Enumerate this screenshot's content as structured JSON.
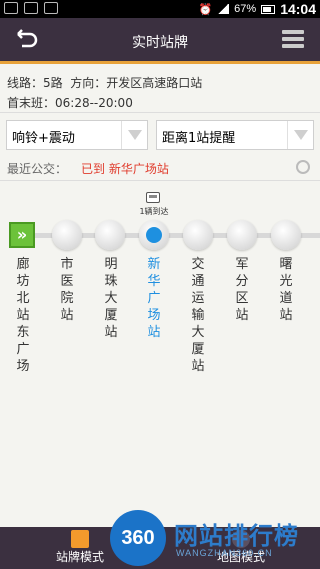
{
  "status": {
    "battery": "67%",
    "time": "14:04"
  },
  "header": {
    "title": "实时站牌"
  },
  "info": {
    "route_label": "线路：5路",
    "direction_label": "方向：开发区高速路口站",
    "schedule_label": "首末班：06:28--20:00"
  },
  "dropdowns": {
    "alert_mode": "响铃+震动",
    "alert_distance": "距离1站提醒"
  },
  "recent": {
    "label": "最近公交：",
    "value": "已到 新华广场站"
  },
  "bus": {
    "text": "1辆到达"
  },
  "stations": [
    "廊坊北站东广场",
    "市医院站",
    "明珠大厦站",
    "新华广场站",
    "交通运输大厦站",
    "军分区站",
    "曙光道站"
  ],
  "bottom": {
    "tab_stop": "站牌模式",
    "tab_map": "地图模式"
  },
  "watermark": {
    "logo": "360",
    "text": "网站排行榜",
    "url": "WANGZHAN360.CN"
  },
  "colors": {
    "header_bg": "#3b3040",
    "accent": "#e8a23a",
    "current": "#1e90e0",
    "arrived": "#e03b2c",
    "start": "#6cc23a"
  }
}
